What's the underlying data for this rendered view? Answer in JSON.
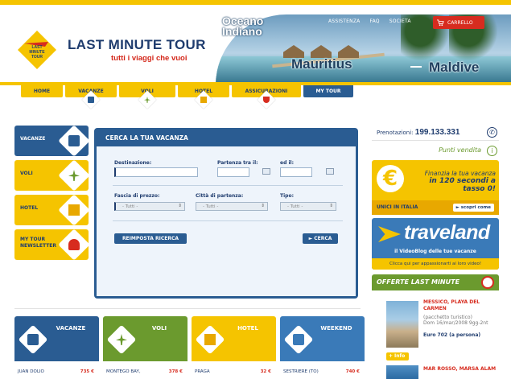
{
  "header": {
    "logo_badge": "LAST MINUTE TOUR",
    "logo_title": "LAST MINUTE TOUR",
    "tagline": "tutti i viaggi che vuoi",
    "photo_text_1": "Oceano",
    "photo_text_2": "Indiano",
    "destination_1": "Mauritius",
    "destination_2": "Maldive",
    "links": [
      "ASSISTENZA",
      "FAQ",
      "SOCIETA"
    ],
    "cart_label": "CARRELLO"
  },
  "nav": {
    "tabs": [
      {
        "label": "HOME",
        "icon": "home-icon"
      },
      {
        "label": "VACANZE",
        "icon": "suitcase-icon"
      },
      {
        "label": "VOLI",
        "icon": "plane-icon"
      },
      {
        "label": "HOTEL",
        "icon": "hotel-icon"
      },
      {
        "label": "ASSICURAZIONI",
        "icon": "shield-icon"
      },
      {
        "label": "MY TOUR",
        "icon": "user-icon"
      }
    ]
  },
  "sidebar": {
    "items": [
      {
        "label": "VACANZE",
        "icon": "suitcase-icon"
      },
      {
        "label": "VOLI",
        "icon": "plane-icon"
      },
      {
        "label": "HOTEL",
        "icon": "hotel-icon"
      },
      {
        "label": "MY TOUR\nNEWSLETTER",
        "icon": "newsletter-user-icon"
      }
    ]
  },
  "search": {
    "title": "CERCA LA TUA VACANZA",
    "destinazione_label": "Destinazione:",
    "partenza_label": "Partenza tra il:",
    "ed_il_label": "ed il:",
    "prezzo_label": "Fascia di prezzo:",
    "citta_label": "Città di partenza:",
    "tipo_label": "Tipo:",
    "prezzo_value": "- Tutti -",
    "citta_value": "- Tutti -",
    "tipo_value": "- Tutti -",
    "reset_label": "REIMPOSTA RICERCA",
    "search_label": "► CERCA"
  },
  "right": {
    "prenotazioni_label": "Prenotazioni:",
    "prenotazioni_number": "199.133.331",
    "punti_vendita": "Punti vendita",
    "finanzia_text_1": "Finanzia la tua vacanza",
    "finanzia_text_2": "in 120 secondi a tasso 0!",
    "finanzia_bottom": "UNICI IN ITALIA",
    "scopri_label": "► scopri come",
    "traveland_title": "traveland",
    "traveland_sub": "il VideoBlog delle tue vacanze",
    "traveland_bar": "Clicca qui per appassionarti ai loro video!",
    "offerte_title": "OFFERTE LAST MINUTE",
    "offer1_title": "MESSICO, PLAYA DEL CARMEN",
    "offer1_desc": "(pacchetto turistico)",
    "offer1_date": "Dom 16/mar/2008 9gg-2nt",
    "offer1_price": "Euro 702 (a persona)",
    "info_label": "Info",
    "offer2_title": "MAR ROSSO, MARSA ALAM"
  },
  "cards": [
    {
      "title": "VACANZE",
      "color": "#2a5c92",
      "icon": "suitcase-icon",
      "row": "JUAN DOLIO",
      "price": "735 €"
    },
    {
      "title": "VOLI",
      "color": "#6b9a2e",
      "icon": "plane-icon",
      "row": "MONTEGO BAY,",
      "price": "378 €"
    },
    {
      "title": "HOTEL",
      "color": "#f5c400",
      "icon": "hotel-icon",
      "row": "PRAGA",
      "price": "32 €"
    },
    {
      "title": "WEEKEND",
      "color": "#3a7ab8",
      "icon": "luggage-icon",
      "row": "SESTRIERE (TO)",
      "price": "740 €"
    }
  ]
}
